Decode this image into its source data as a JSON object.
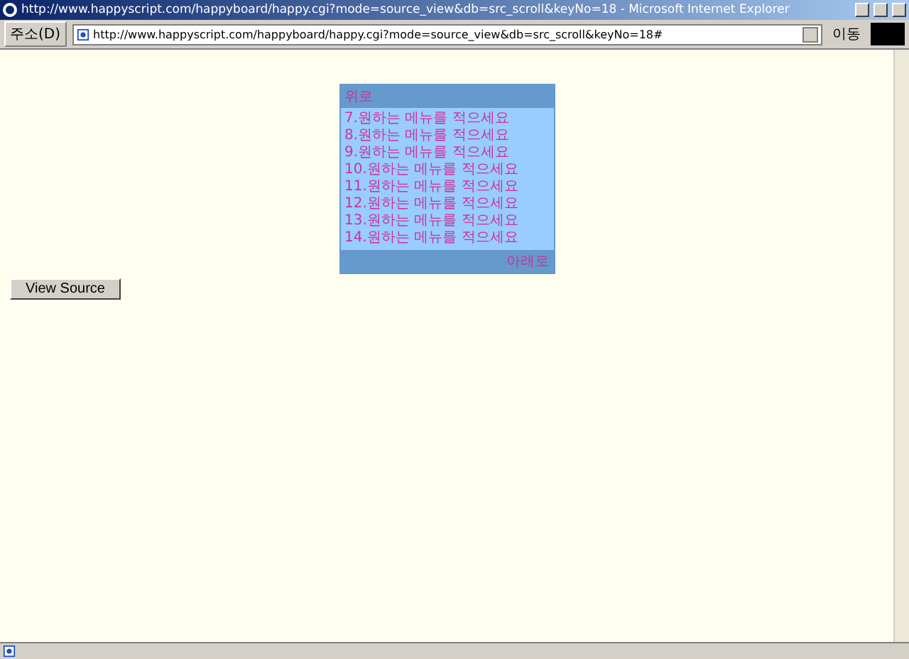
{
  "window": {
    "title": "http://www.happyscript.com/happyboard/happy.cgi?mode=source_view&db=src_scroll&keyNo=18 - Microsoft Internet Explorer"
  },
  "address_bar": {
    "label": "주소(D)",
    "value": "http://www.happyscript.com/happyboard/happy.cgi?mode=source_view&db=src_scroll&keyNo=18#",
    "go_button": "이동"
  },
  "scroll_menu": {
    "up": "위로",
    "items": [
      "7.원하는 메뉴를 적으세요",
      "8.원하는 메뉴를 적으세요",
      "9.원하는 메뉴를 적으세요",
      "10.원하는 메뉴를 적으세요",
      "11.원하는 메뉴를 적으세요",
      "12.원하는 메뉴를 적으세요",
      "13.원하는 메뉴를 적으세요",
      "14.원하는 메뉴를 적으세요"
    ],
    "down": "아래로"
  },
  "view_source_button": "View Source"
}
